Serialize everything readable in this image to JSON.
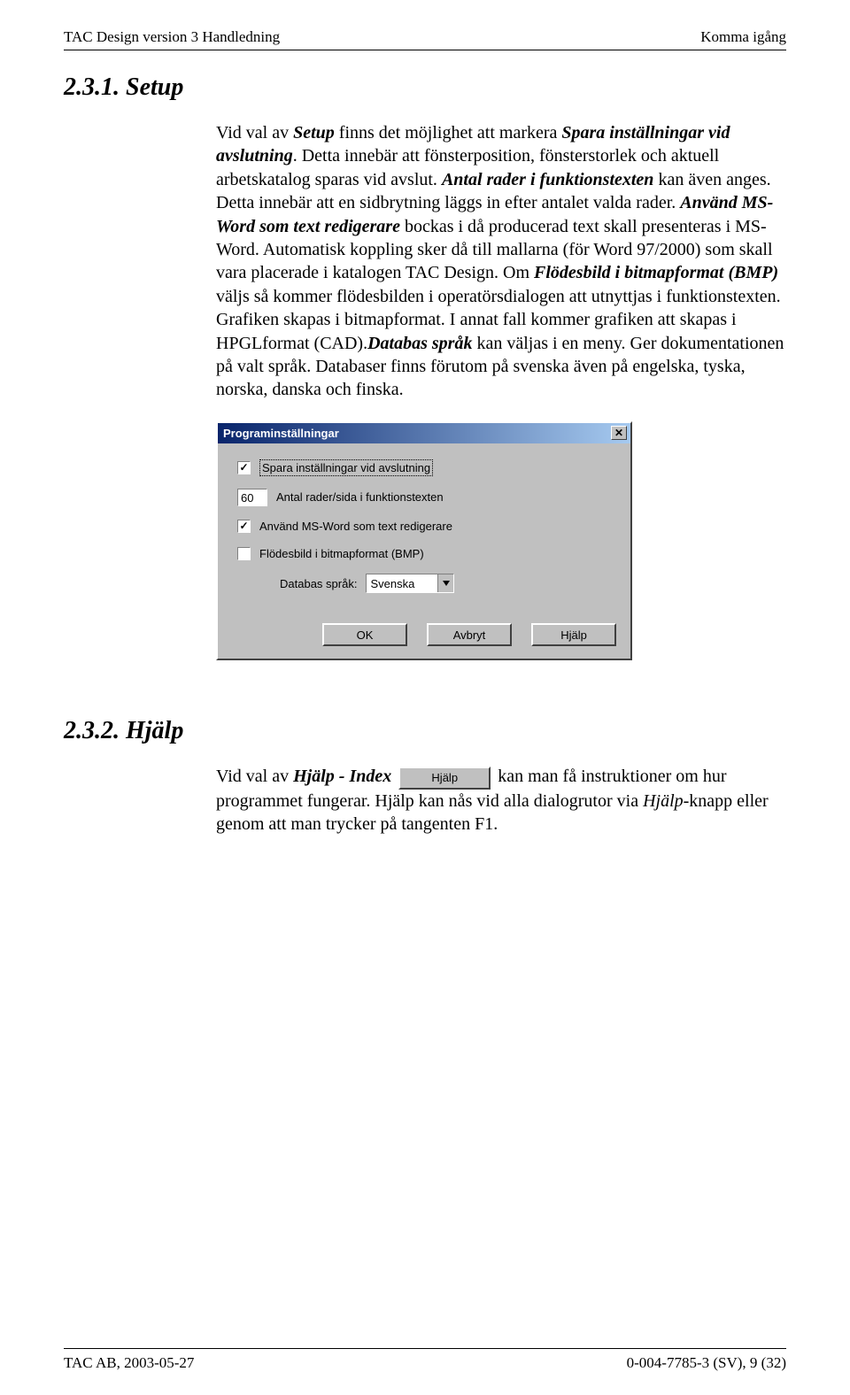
{
  "header": {
    "left": "TAC Design version 3  Handledning",
    "right": "Komma igång"
  },
  "section231": {
    "heading": "2.3.1. Setup",
    "para_html": "Vid val av <span class='b-italic'>Setup</span> finns det möjlighet att markera <span class='b-italic'>Spara inställningar vid avslutning</span>. Detta innebär att fönsterposition, fönsterstorlek och aktuell arbetskatalog sparas vid avslut. <span class='b-italic'>Antal rader i funktionstexten</span> kan även anges. Detta innebär att en sidbrytning läggs in efter antalet valda rader. <span class='b-italic'>Använd MS-Word som text redigerare</span> bockas i då producerad text skall presenteras i MS-Word. Automatisk koppling sker då till mallarna (för Word 97/2000) som skall vara placerade i katalogen TAC Design. Om <span class='b-italic'>Flödesbild i bitmapformat (BMP)</span> väljs så kommer flödesbilden i operatörsdialogen att utnyttjas i funktionstexten. Grafiken skapas i bitmapformat. I annat fall kommer grafiken att skapas i HPGLformat (CAD).<span class='b-italic'>Databas språk</span> kan väljas i en meny. Ger dokumentationen på valt språk. Databaser finns förutom på svenska även på engelska, tyska, norska, danska och finska."
  },
  "dialog": {
    "title": "Programinställningar",
    "opt_save": "Spara inställningar vid avslutning",
    "rows_value": "60",
    "opt_rows": "Antal rader/sida i funktionstexten",
    "opt_msword": "Använd MS-Word som text redigerare",
    "opt_bmp": "Flödesbild i bitmapformat (BMP)",
    "db_label": "Databas språk:",
    "db_value": "Svenska",
    "btn_ok": "OK",
    "btn_cancel": "Avbryt",
    "btn_help": "Hjälp"
  },
  "section232": {
    "heading": "2.3.2. Hjälp",
    "pre": "Vid val av ",
    "term1": "Hjälp - Index",
    "inline_btn": "Hjälp",
    "post1": " kan man få instruktioner om hur programmet fungerar. Hjälp kan nås vid alla dialogrutor via ",
    "term2": "Hjälp",
    "post2": "-knapp eller genom att man trycker på tangenten F1."
  },
  "footer": {
    "left": "TAC AB, 2003-05-27",
    "right": "0-004-7785-3 (SV), 9 (32)"
  }
}
